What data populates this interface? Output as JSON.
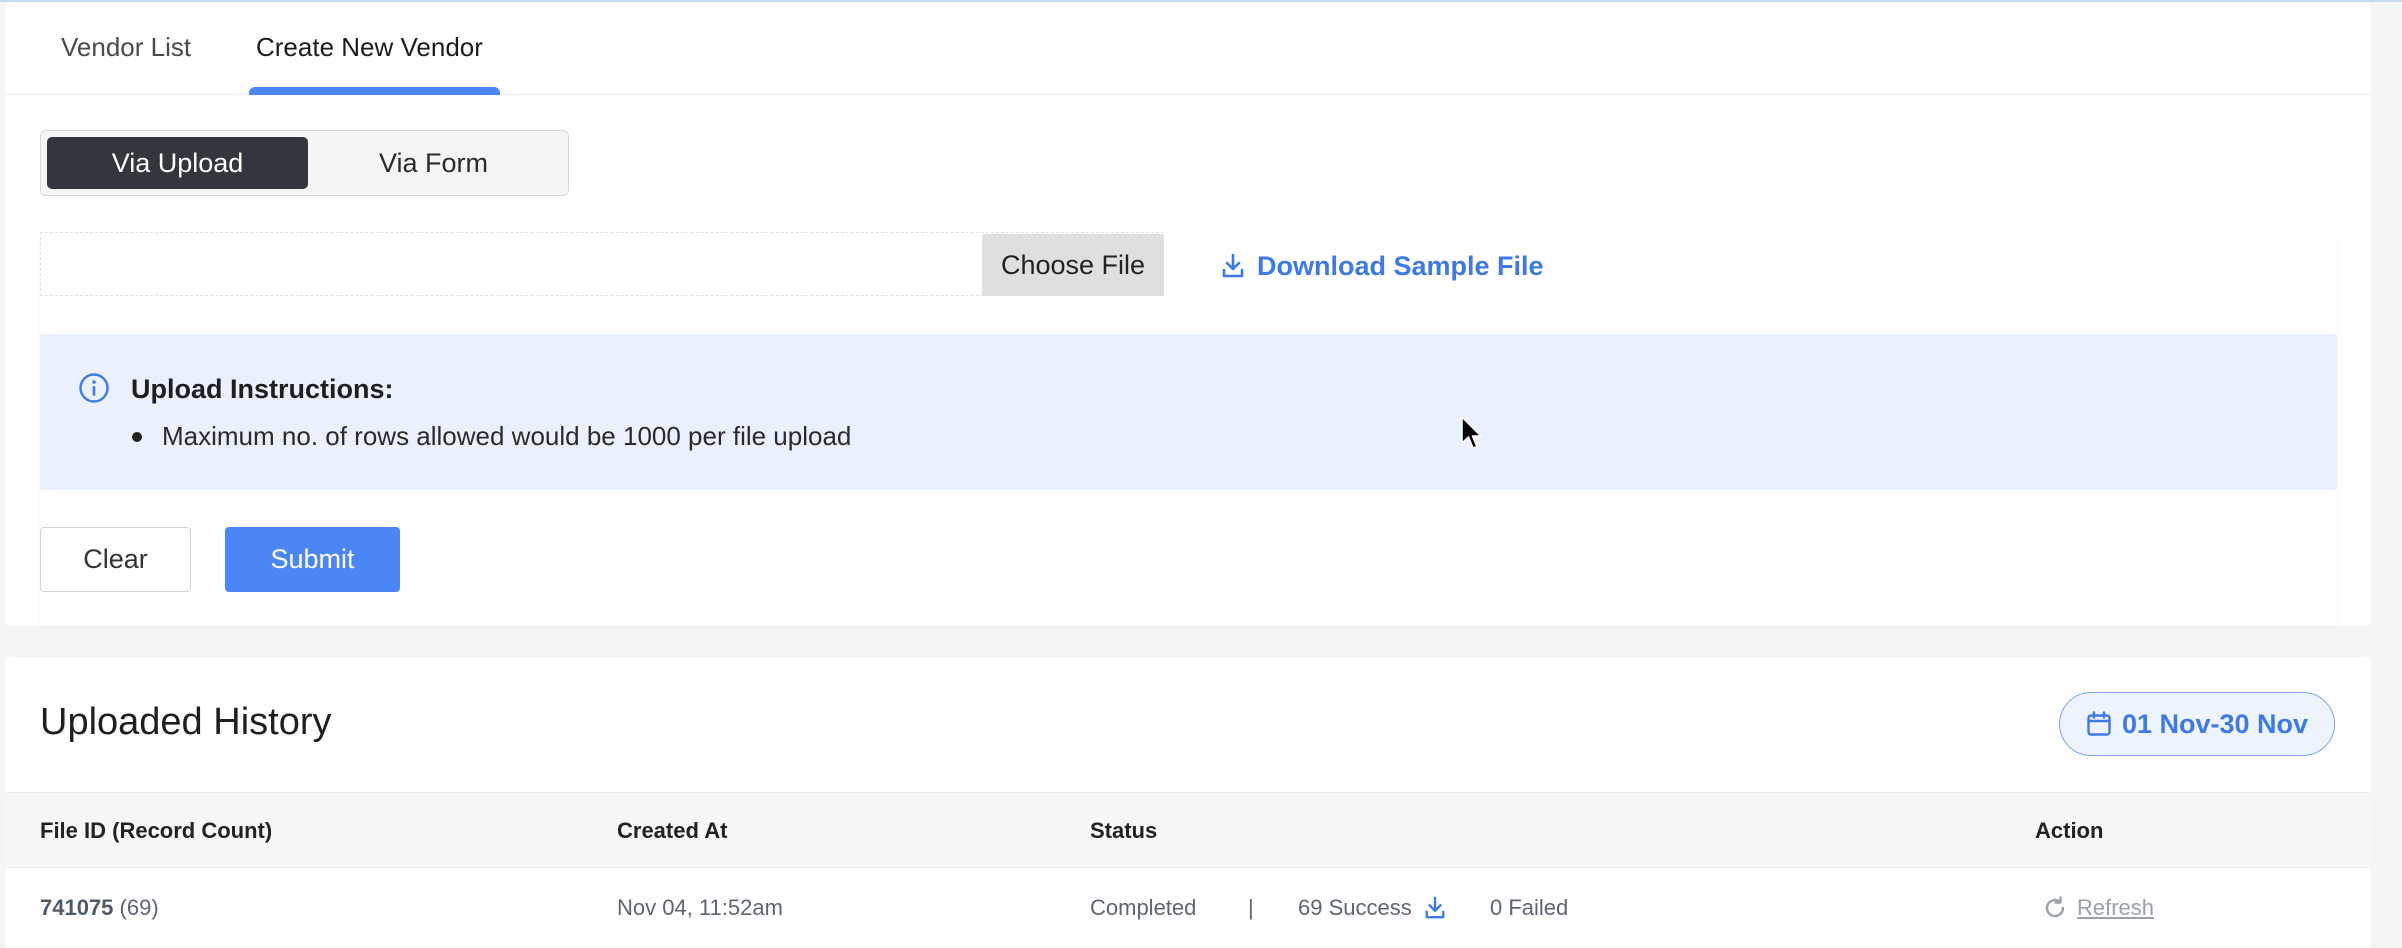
{
  "tabs": {
    "vendor_list": "Vendor List",
    "create_new_vendor": "Create New Vendor",
    "active": "Create New Vendor"
  },
  "mode_toggle": {
    "via_upload": "Via Upload",
    "via_form": "Via Form",
    "selected": "Via Upload"
  },
  "upload": {
    "choose_file_label": "Choose File",
    "download_sample_label": "Download Sample File"
  },
  "instructions": {
    "title": "Upload Instructions:",
    "items": [
      "Maximum no. of rows allowed would be 1000 per file upload"
    ]
  },
  "actions": {
    "clear_label": "Clear",
    "submit_label": "Submit"
  },
  "history": {
    "title": "Uploaded History",
    "date_range": "01 Nov-30 Nov",
    "columns": [
      "File ID (Record Count)",
      "Created At",
      "Status",
      "Action"
    ],
    "rows": [
      {
        "file_id": "741075",
        "record_count": "(69)",
        "created_at": "Nov 04, 11:52am",
        "status": "Completed",
        "separator": "|",
        "success": "69 Success",
        "failed": "0 Failed",
        "action": "Refresh"
      }
    ]
  },
  "colors": {
    "accent": "#4a86f5",
    "link": "#3d7ae6",
    "dark_toggle": "#33373d",
    "info_bg": "#eaf1fd"
  },
  "icons": [
    "download-icon",
    "info-icon",
    "calendar-icon",
    "refresh-icon",
    "mouse-cursor-icon"
  ]
}
